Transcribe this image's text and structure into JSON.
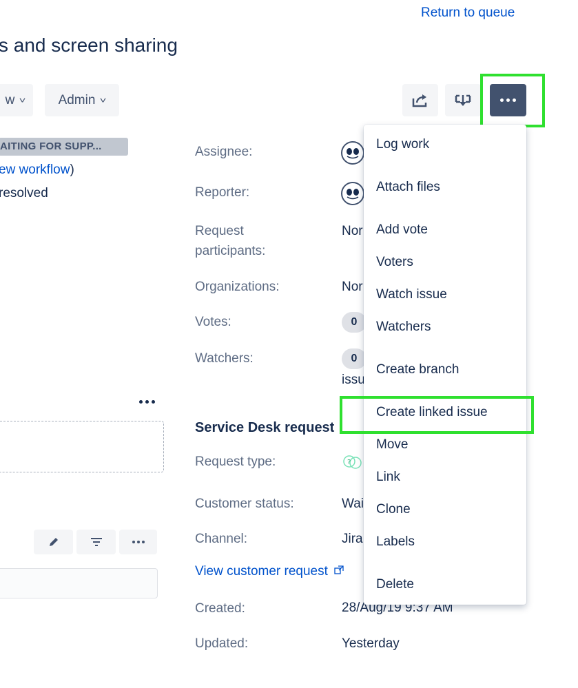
{
  "header": {
    "return_link": "Return to queue",
    "title": "s and screen sharing"
  },
  "toolbar": {
    "workflow_label": "w",
    "admin_label": "Admin",
    "share_icon": "share-icon",
    "export_icon": "export-icon",
    "more_icon": "more-icon"
  },
  "details": {
    "status": "AITING FOR SUPP...",
    "view_workflow_link": "ew workflow",
    "view_workflow_close": ")",
    "resolution": "resolved"
  },
  "people": {
    "assignee_label": "Assignee:",
    "reporter_label": "Reporter:",
    "request_participants_label_1": "Request",
    "request_participants_label_2": "participants:",
    "request_participants_value": "Nor",
    "organizations_label": "Organizations:",
    "organizations_value": "Nor",
    "votes_label": "Votes:",
    "votes_count": "0",
    "watchers_label": "Watchers:",
    "watchers_count": "0",
    "watchers_link": "issu"
  },
  "service_desk": {
    "title": "Service Desk request",
    "request_type_label": "Request type:",
    "customer_status_label": "Customer status:",
    "customer_status_value": "Wai",
    "channel_label": "Channel:",
    "channel_value": "Jira",
    "view_customer_request": "View customer request"
  },
  "dates": {
    "created_label": "Created:",
    "created_value": "28/Aug/19 9:37 AM",
    "updated_label": "Updated:",
    "updated_value": "Yesterday"
  },
  "more_menu": {
    "items": [
      "Log work",
      "Attach files",
      "Add vote",
      "Voters",
      "Watch issue",
      "Watchers",
      "Create branch",
      "Create linked issue",
      "Move",
      "Link",
      "Clone",
      "Labels",
      "Delete"
    ]
  },
  "colors": {
    "link": "#0052cc",
    "text": "#172b4d",
    "label": "#5e6c84",
    "button_bg": "#f4f5f7",
    "more_button_bg": "#42526e",
    "highlight": "#2fe02f"
  }
}
